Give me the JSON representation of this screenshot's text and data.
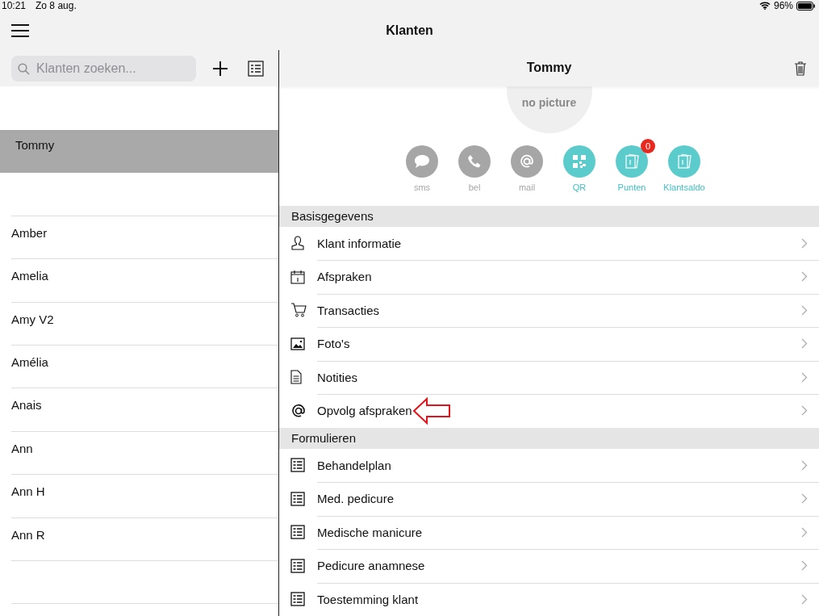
{
  "status_bar": {
    "time": "10:21",
    "date": "Zo 8 aug.",
    "battery": "96%"
  },
  "nav": {
    "title": "Klanten"
  },
  "search": {
    "placeholder": "Klanten zoeken..."
  },
  "clients": [
    {
      "name": "Tommy",
      "selected": true
    },
    {
      "name": "Amber",
      "selected": false
    },
    {
      "name": "Amelia",
      "selected": false
    },
    {
      "name": "Amy  V2",
      "selected": false
    },
    {
      "name": "Amélia",
      "selected": false
    },
    {
      "name": "Anais",
      "selected": false
    },
    {
      "name": "Ann",
      "selected": false
    },
    {
      "name": "Ann H",
      "selected": false
    },
    {
      "name": "Ann R",
      "selected": false
    }
  ],
  "detail": {
    "title": "Tommy",
    "avatar": "no picture",
    "actions": [
      {
        "kind": "sms",
        "label": "sms",
        "enabled": false
      },
      {
        "kind": "phone",
        "label": "bel",
        "enabled": false
      },
      {
        "kind": "mail",
        "label": "mail",
        "enabled": false
      },
      {
        "kind": "qr",
        "label": "QR",
        "enabled": true
      },
      {
        "kind": "card",
        "label": "Punten",
        "enabled": true,
        "badge": "0"
      },
      {
        "kind": "card",
        "label": "Klantsaldo",
        "enabled": true
      }
    ],
    "sections": [
      {
        "title": "Basisgegevens",
        "rows": [
          {
            "kind": "person",
            "label": "Klant informatie",
            "callout": false
          },
          {
            "kind": "calendar",
            "label": "Afspraken",
            "callout": false
          },
          {
            "kind": "cart",
            "label": "Transacties",
            "callout": false
          },
          {
            "kind": "image",
            "label": "Foto's",
            "callout": false
          },
          {
            "kind": "document",
            "label": "Notities",
            "callout": false
          },
          {
            "kind": "at",
            "label": "Opvolg afspraken",
            "callout": true
          }
        ]
      },
      {
        "title": "Formulieren",
        "rows": [
          {
            "kind": "form",
            "label": "Behandelplan",
            "callout": false
          },
          {
            "kind": "form",
            "label": "Med. pedicure",
            "callout": false
          },
          {
            "kind": "form",
            "label": "Medische manicure",
            "callout": false
          },
          {
            "kind": "form",
            "label": "Pedicure anamnese",
            "callout": false
          },
          {
            "kind": "form",
            "label": "Toestemming klant",
            "callout": false
          }
        ]
      }
    ]
  }
}
